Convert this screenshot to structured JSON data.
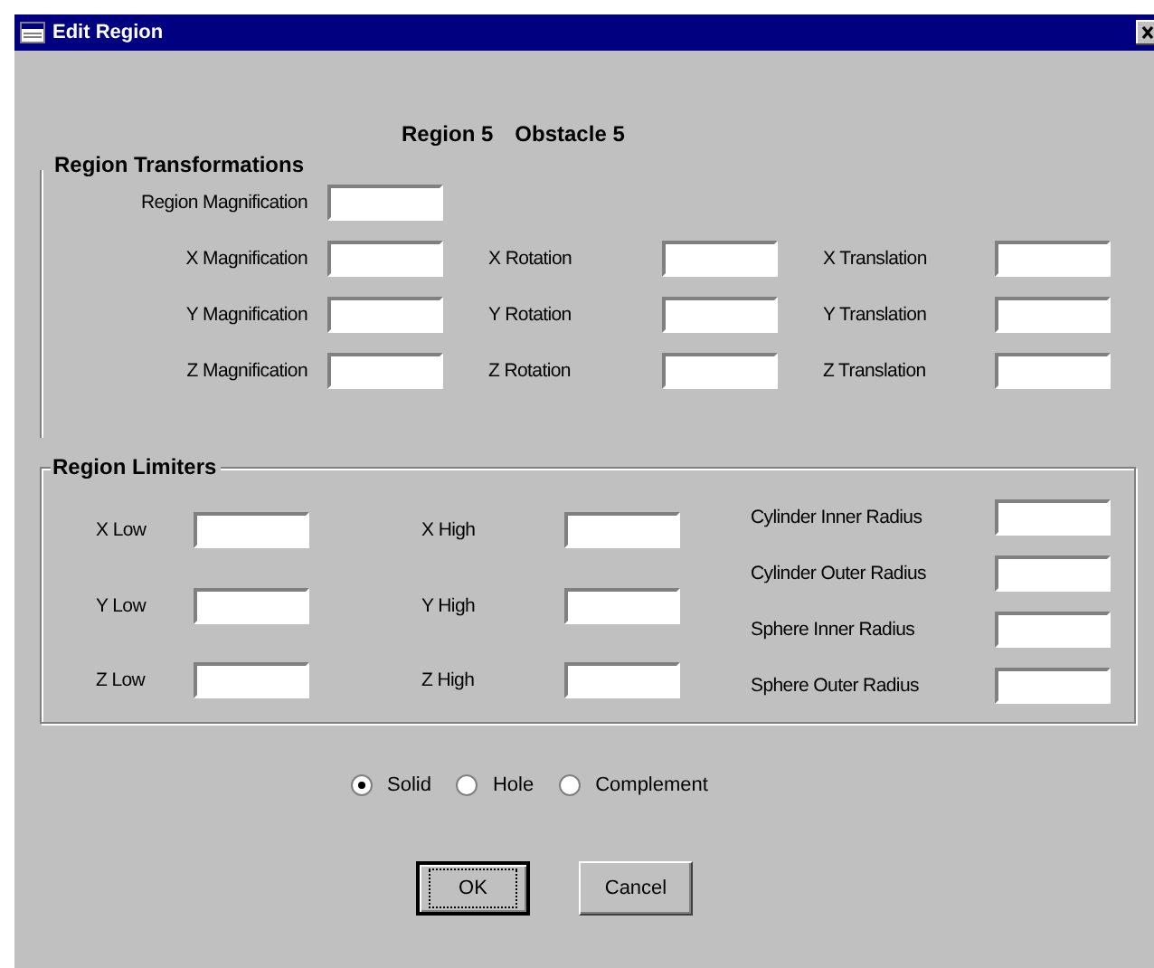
{
  "window": {
    "title": "Edit Region"
  },
  "heading": {
    "region": "Region 5",
    "obstacle": "Obstacle 5"
  },
  "transformations": {
    "legend": "Region Transformations",
    "magnification": "Region Magnification",
    "rows": [
      [
        "X Magnification",
        "X Rotation",
        "X Translation"
      ],
      [
        "Y Magnification",
        "Y Rotation",
        "Y Translation"
      ],
      [
        "Z Magnification",
        "Z Rotation",
        "Z Translation"
      ]
    ]
  },
  "limiters": {
    "legend": "Region Limiters",
    "rows": [
      [
        "X Low",
        "X High"
      ],
      [
        "Y Low",
        "Y High"
      ],
      [
        "Z Low",
        "Z High"
      ]
    ],
    "radii": [
      "Cylinder Inner Radius",
      "Cylinder Outer Radius",
      "Sphere Inner Radius",
      "Sphere Outer Radius"
    ]
  },
  "radios": [
    {
      "label": "Solid",
      "selected": true
    },
    {
      "label": "Hole",
      "selected": false
    },
    {
      "label": "Complement",
      "selected": false
    }
  ],
  "buttons": [
    {
      "label": "OK",
      "default": true
    },
    {
      "label": "Cancel",
      "default": false
    }
  ]
}
